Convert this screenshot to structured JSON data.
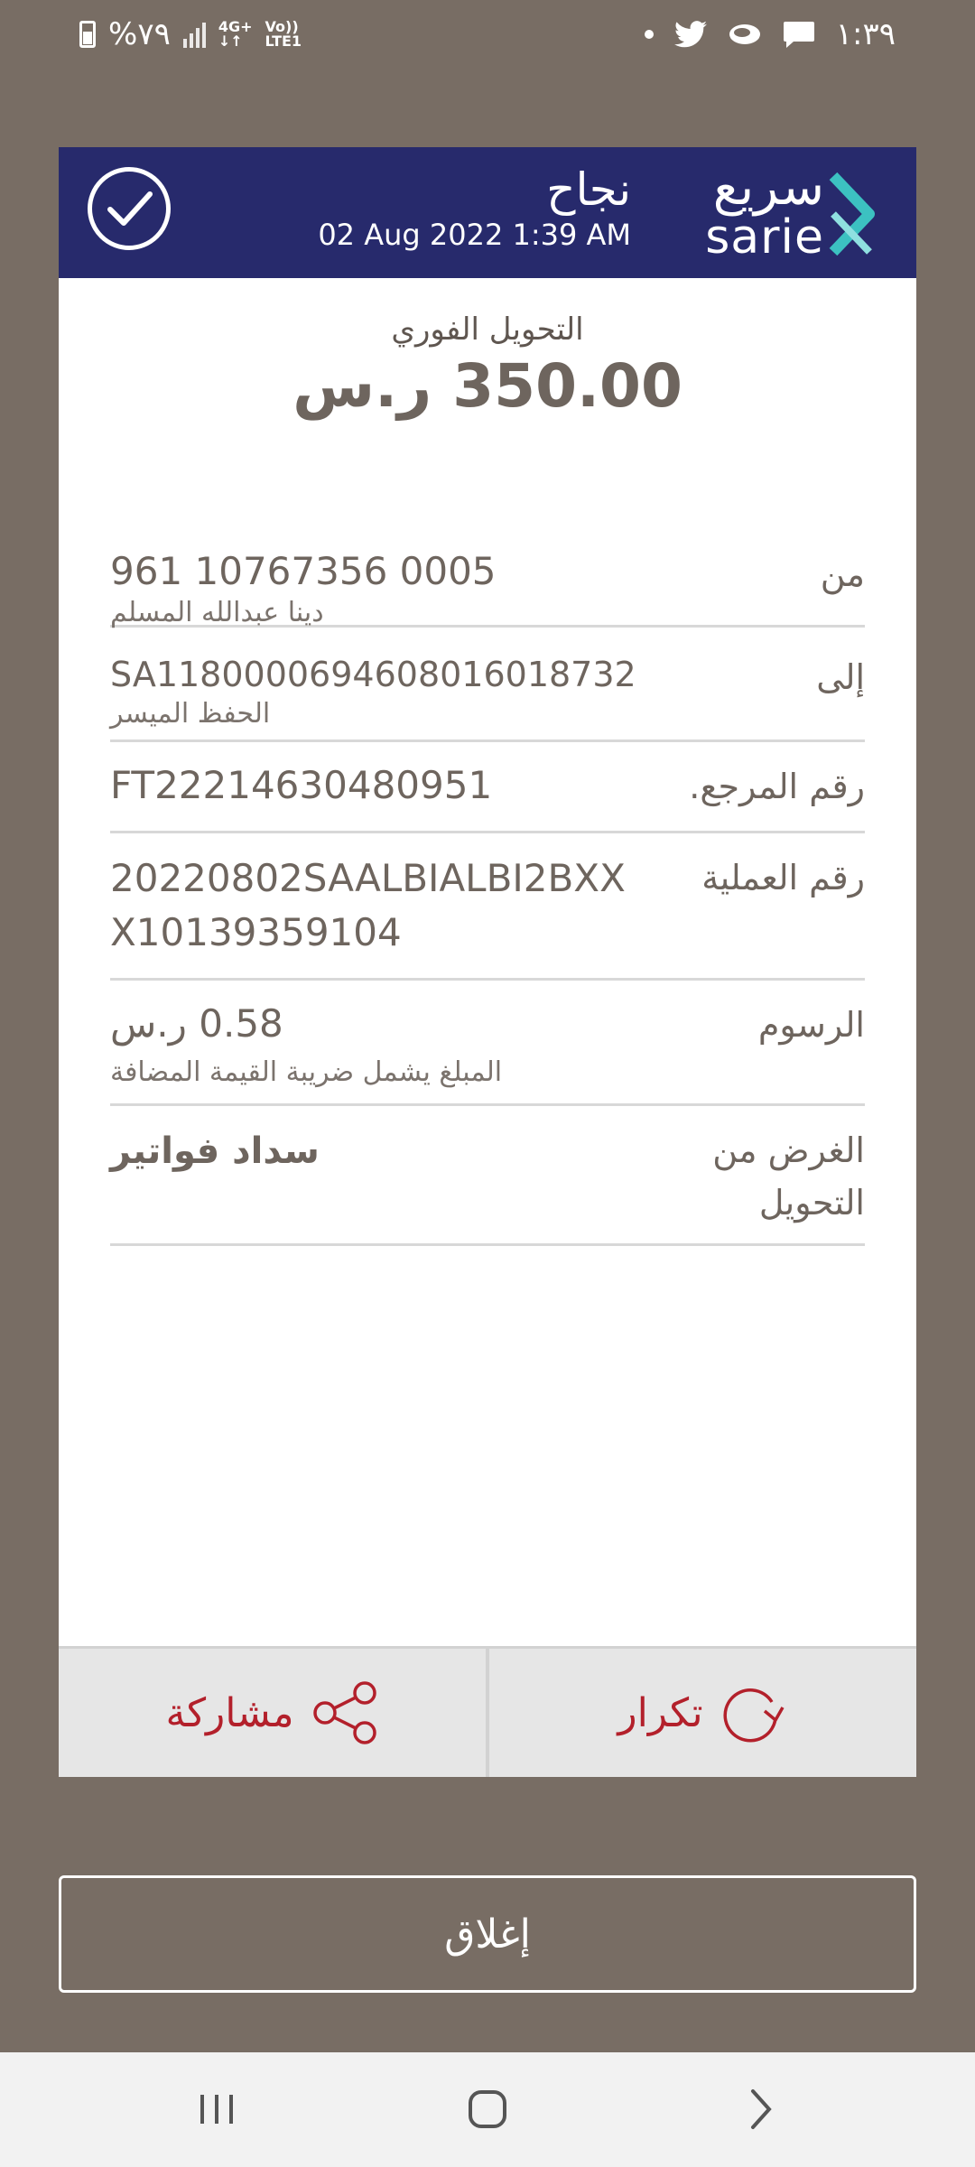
{
  "status_bar": {
    "battery": "%٧٩",
    "network": "4G+",
    "volte": "Vo))",
    "lte": "LTE1",
    "time": "١:٣٩"
  },
  "header": {
    "status": "نجاح",
    "date": "02 Aug 2022 1:39 AM",
    "logo_ar": "سريع",
    "logo_en": "sarie"
  },
  "transfer": {
    "type": "التحويل الفوري",
    "amount": "350.00 ر.س"
  },
  "details": {
    "from_label": "من",
    "from_value": "961  10767356  0005",
    "from_name": "دينا عبدالله المسلم",
    "to_label": "إلى",
    "to_value": "SA1180000694608016018732",
    "to_name": "الحفظ الميسر",
    "ref_label": "رقم المرجع.",
    "ref_value": "FT22214630480951",
    "op_label": "رقم العملية",
    "op_value_line1": "20220802SAALBIALBI2BXX",
    "op_value_line2": "X10139359104",
    "fees_label": "الرسوم",
    "fees_value": "0.58 ر.س",
    "fees_note": "المبلغ يشمل ضريبة القيمة المضافة",
    "purpose_label_line1": "الغرض من",
    "purpose_label_line2": "التحويل",
    "purpose_value": "سداد فواتير"
  },
  "actions": {
    "share": "مشاركة",
    "repeat": "تكرار"
  },
  "close": "إغلاق",
  "colors": {
    "background": "#786d64",
    "header": "#272a6c",
    "accent_red": "#b3202b",
    "logo_teal": "#3cc1c1"
  },
  "icons": [
    "battery-icon",
    "signal-icon",
    "twitter-icon",
    "chat-icon",
    "message-icon",
    "check-circle-icon",
    "sarie-logo",
    "share-icon",
    "repeat-icon",
    "recents-icon",
    "home-icon",
    "back-icon"
  ]
}
